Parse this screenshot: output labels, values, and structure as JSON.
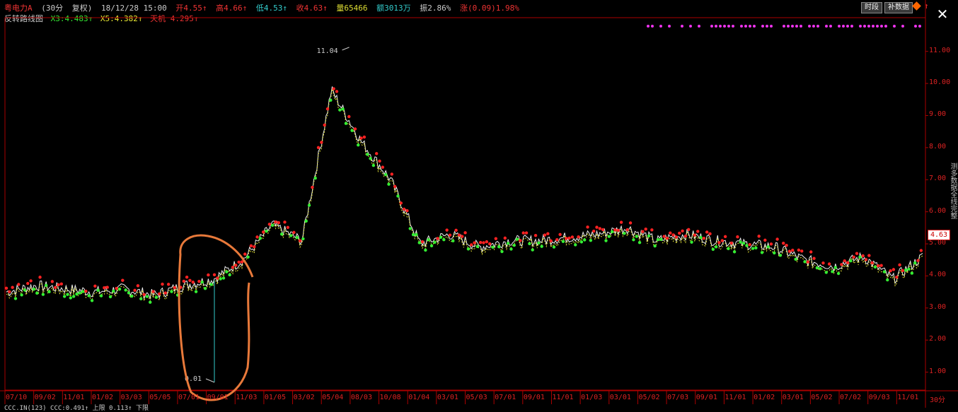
{
  "header": {
    "stock_name": "粤电力A",
    "period": "(30分",
    "mode": "复权)",
    "datetime": "18/12/28 15:00",
    "open": "开4.55↑",
    "high": "高4.66↑",
    "low": "低4.53↑",
    "close": "收4.63↑",
    "volume": "量65466",
    "amount": "额3013万",
    "amplitude": "振2.86%",
    "change": "涨(0.09)1.98%"
  },
  "indicator": {
    "name": "反转路线图",
    "x3": "X3:4.483↑",
    "x5": "X5:4.382↑",
    "tianji": "天机 4.295↑"
  },
  "toolbar": {
    "btn_time": "时段",
    "btn_fill": "补数据"
  },
  "chart": {
    "high_label": "11.04",
    "low_label": "0.01",
    "current_price": "4.63",
    "y_ticks": [
      "11.00",
      "10.00",
      "9.00",
      "8.00",
      "7.00",
      "6.00",
      "5.00",
      "4.00",
      "3.00",
      "2.00",
      "1.00"
    ],
    "x_ticks": [
      "07/10",
      "09/02",
      "11/01",
      "01/02",
      "03/03",
      "05/05",
      "07/01",
      "09/01",
      "11/03",
      "01/05",
      "03/02",
      "05/04",
      "08/03",
      "10/08",
      "01/04",
      "03/01",
      "05/03",
      "07/01",
      "09/01",
      "11/01",
      "01/03",
      "03/01",
      "05/02",
      "07/03",
      "09/01",
      "11/01",
      "01/02",
      "03/01",
      "05/02",
      "07/02",
      "09/03",
      "11/01"
    ],
    "period_label": "30分",
    "side_text": "测多数据全线完整"
  },
  "chart_data": {
    "type": "line",
    "title": "",
    "x": [
      "07/10",
      "09/02",
      "11/01",
      "01/02",
      "03/03",
      "05/05",
      "07/01",
      "09/01",
      "11/03",
      "01/05",
      "03/02",
      "05/04",
      "08/03",
      "10/08",
      "01/04",
      "03/01",
      "05/03",
      "07/01",
      "09/01",
      "11/01",
      "01/03",
      "03/01",
      "05/02",
      "07/03",
      "09/01",
      "11/01",
      "01/02",
      "03/01",
      "05/02",
      "07/02",
      "09/03",
      "11/01"
    ],
    "series": [
      {
        "values": [
          3.5,
          3.7,
          3.6,
          3.5,
          3.6,
          3.4,
          3.7,
          3.9,
          4.5,
          5.6,
          5.1,
          9.8,
          8.2,
          7.0,
          5.0,
          5.3,
          4.9,
          5.1,
          5.1,
          5.2,
          5.3,
          5.5,
          5.1,
          5.3,
          5.1,
          5.0,
          4.9,
          4.5,
          4.3,
          4.6,
          3.9,
          4.6
        ]
      }
    ],
    "ylim": [
      0,
      11.5
    ],
    "high": 11.04,
    "spike_low": 0.01,
    "last": 4.63
  },
  "bottom": {
    "text": "CCC.IN(123) CCC:0.491↑ 上限 0.113↑ 下限"
  }
}
